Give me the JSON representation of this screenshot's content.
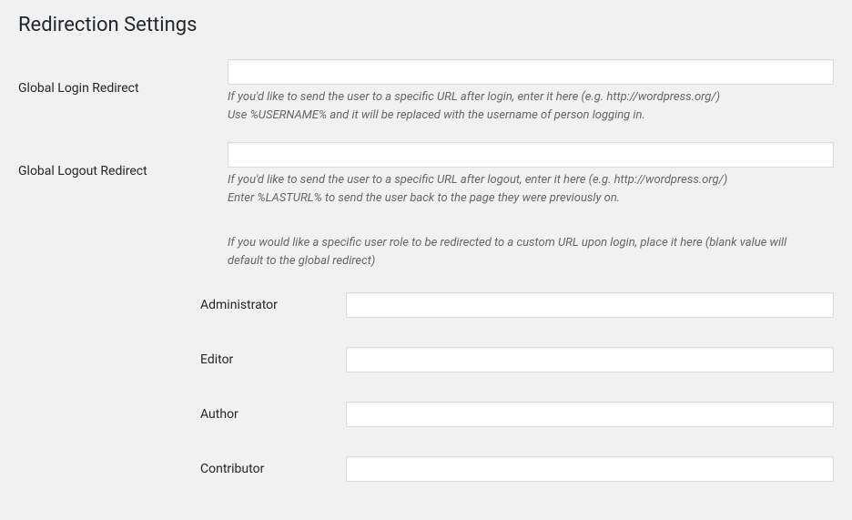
{
  "page": {
    "title": "Redirection Settings"
  },
  "global_login": {
    "label": "Global Login Redirect",
    "value": "",
    "desc_line1": "If you'd like to send the user to a specific URL after login, enter it here (e.g. http://wordpress.org/)",
    "desc_line2": "Use %USERNAME% and it will be replaced with the username of person logging in."
  },
  "global_logout": {
    "label": "Global Logout Redirect",
    "value": "",
    "desc_line1": "If you'd like to send the user to a specific URL after logout, enter it here (e.g. http://wordpress.org/)",
    "desc_line2": "Enter %LASTURL% to send the user back to the page they were previously on."
  },
  "roles_section": {
    "intro": "If you would like a specific user role to be redirected to a custom URL upon login, place it here (blank value will default to the global redirect)"
  },
  "roles": [
    {
      "label": "Administrator",
      "value": ""
    },
    {
      "label": "Editor",
      "value": ""
    },
    {
      "label": "Author",
      "value": ""
    },
    {
      "label": "Contributor",
      "value": ""
    }
  ]
}
